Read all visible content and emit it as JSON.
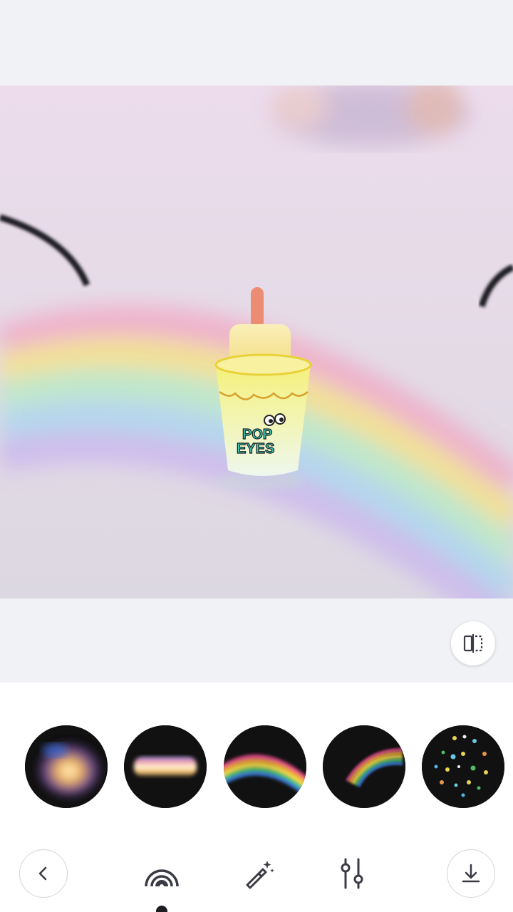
{
  "photo": {
    "subject": "popsicle-in-cup",
    "cup_text_line1": "POP",
    "cup_text_line2": "EYES"
  },
  "compare": {
    "icon": "compare-split-icon"
  },
  "filters": [
    {
      "name": "light-leak-warm",
      "icon": "filter-thumb-1"
    },
    {
      "name": "light-bar",
      "icon": "filter-thumb-2"
    },
    {
      "name": "rainbow-arc-wide",
      "icon": "filter-thumb-3"
    },
    {
      "name": "rainbow-arc-small",
      "icon": "filter-thumb-4"
    },
    {
      "name": "prism-sparkles",
      "icon": "filter-thumb-5"
    }
  ],
  "toolbar": {
    "back": {
      "icon": "chevron-left-icon"
    },
    "rainbow": {
      "icon": "rainbow-icon",
      "active": true
    },
    "magic": {
      "icon": "magic-wand-icon"
    },
    "adjust": {
      "icon": "sliders-icon"
    },
    "download": {
      "icon": "download-icon"
    }
  },
  "colors": {
    "canvas_bg": "#f1f2f6",
    "icon_color": "#3a3b44",
    "active_indicator": "#1d1d22"
  }
}
